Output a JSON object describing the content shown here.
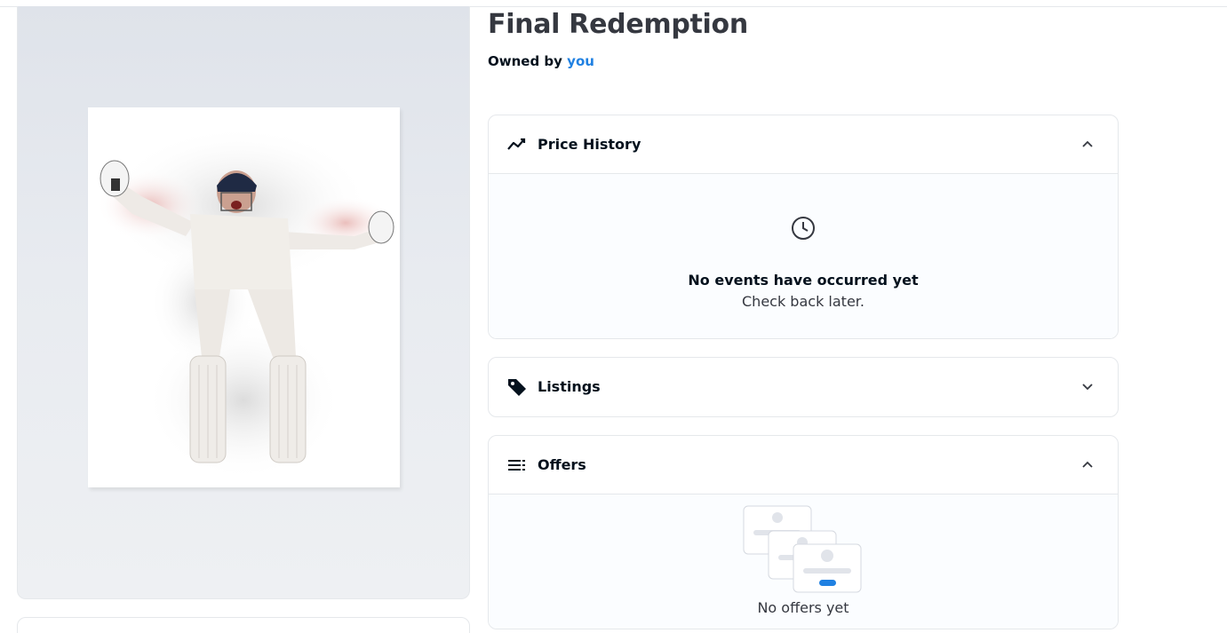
{
  "item": {
    "title": "Final Redemption",
    "owned_by_prefix": "Owned by",
    "owner": "you"
  },
  "price_history": {
    "label": "Price History",
    "icon": "trending-line-icon",
    "expanded": true,
    "empty_title": "No events have occurred yet",
    "empty_subtitle": "Check back later."
  },
  "listings": {
    "label": "Listings",
    "icon": "tag-icon",
    "expanded": false
  },
  "offers": {
    "label": "Offers",
    "icon": "list-icon",
    "expanded": true,
    "empty_text": "No offers yet"
  },
  "colors": {
    "link": "#2081e2",
    "title": "#353840",
    "border": "#e5e8eb"
  }
}
